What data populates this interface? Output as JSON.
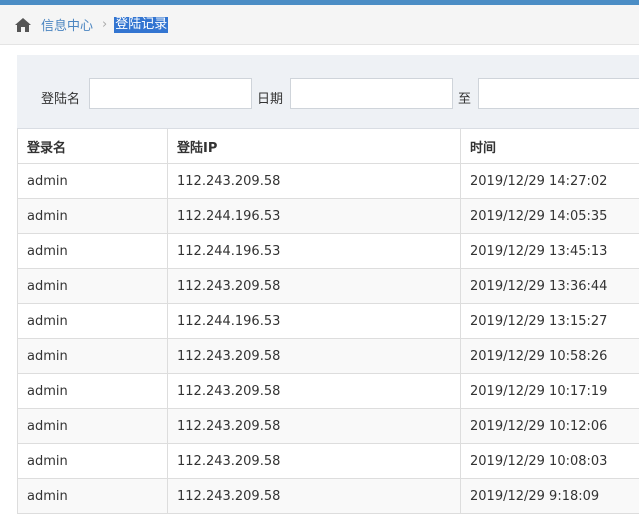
{
  "breadcrumb": {
    "home_icon": "home-icon",
    "parent": "信息中心",
    "separator": "›",
    "current": "登陆记录"
  },
  "filters": {
    "login_name_label": "登陆名",
    "login_name_value": "",
    "date_label": "日期",
    "date_from_value": "",
    "to_label": "至",
    "date_to_value": ""
  },
  "table": {
    "headers": [
      "登录名",
      "登陆IP",
      "时间"
    ],
    "rows": [
      [
        "admin",
        "112.243.209.58",
        "2019/12/29 14:27:02"
      ],
      [
        "admin",
        "112.244.196.53",
        "2019/12/29 14:05:35"
      ],
      [
        "admin",
        "112.244.196.53",
        "2019/12/29 13:45:13"
      ],
      [
        "admin",
        "112.243.209.58",
        "2019/12/29 13:36:44"
      ],
      [
        "admin",
        "112.244.196.53",
        "2019/12/29 13:15:27"
      ],
      [
        "admin",
        "112.243.209.58",
        "2019/12/29 10:58:26"
      ],
      [
        "admin",
        "112.243.209.58",
        "2019/12/29 10:17:19"
      ],
      [
        "admin",
        "112.243.209.58",
        "2019/12/29 10:12:06"
      ],
      [
        "admin",
        "112.243.209.58",
        "2019/12/29 10:08:03"
      ],
      [
        "admin",
        "112.243.209.58",
        "2019/12/29 9:18:09"
      ]
    ]
  },
  "colors": {
    "top_strip": "#4b8dc5",
    "link": "#4c86c1",
    "selected_highlight": "#3375d1",
    "filter_bar_bg": "#eef1f5"
  }
}
